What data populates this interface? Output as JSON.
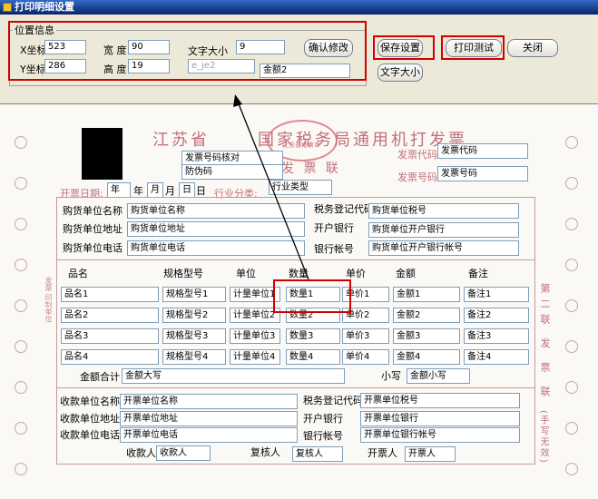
{
  "window": {
    "title": "打印明细设置"
  },
  "position_group": {
    "label": "位置信息",
    "x_label": "X坐标",
    "x_value": "523",
    "y_label": "Y坐标",
    "y_value": "286",
    "width_label": "宽 度",
    "width_value": "90",
    "height_label": "高 度",
    "height_value": "19",
    "font_size_label": "文字大小",
    "font_size_value": "9",
    "field_disabled": "e_je2",
    "field_name": "金额2",
    "confirm_button": "确认修改"
  },
  "toolbar": {
    "save_button": "保存设置",
    "print_test_button": "打印测试",
    "close_button": "关闭",
    "font_size_button": "文字大小"
  },
  "invoice": {
    "province": "江苏省",
    "title": "国家税务局通用机打发票",
    "fa_piao_lian": "发 票 联",
    "seal_text": "江苏省南京市",
    "check_code": "发票号码核对",
    "anti_fake": "防伪码",
    "invoice_code_label": "发票代码",
    "invoice_code": "发票代码",
    "invoice_no_label": "发票号码",
    "invoice_no": "发票号码",
    "date_label": "开票日期:",
    "year_box": "年",
    "year": "年",
    "month_box": "月",
    "month": "月",
    "day_box": "日",
    "day": "日",
    "industry_label": "行业分类:",
    "industry": "行业类型",
    "buyer_name_label": "购货单位名称",
    "buyer_name": "购货单位名称",
    "buyer_addr_label": "购货单位地址",
    "buyer_addr": "购货单位地址",
    "buyer_phone_label": "购货单位电话",
    "buyer_phone": "购货单位电话",
    "buyer_tax_label": "税务登记代码",
    "buyer_tax": "购货单位税号",
    "buyer_bank_label": "开户银行",
    "buyer_bank": "购货单位开户银行",
    "buyer_account_label": "银行帐号",
    "buyer_account": "购货单位开户银行帐号",
    "columns": [
      "品名",
      "规格型号",
      "单位",
      "数量",
      "单价",
      "金额",
      "备注"
    ],
    "rows": [
      [
        "品名1",
        "规格型号1",
        "计量单位1",
        "数量1",
        "单价1",
        "金额1",
        "备注1"
      ],
      [
        "品名2",
        "规格型号2",
        "计量单位2",
        "数量2",
        "单价2",
        "金额2",
        "备注2"
      ],
      [
        "品名3",
        "规格型号3",
        "计量单位3",
        "数量3",
        "单价3",
        "金额3",
        "备注3"
      ],
      [
        "品名4",
        "规格型号4",
        "计量单位4",
        "数量4",
        "单价4",
        "金额4",
        "备注4"
      ]
    ],
    "total_label": "金额合计",
    "total_upper": "金额大写",
    "subtotal_label": "小写",
    "subtotal": "金额小写",
    "seller_name_label": "收款单位名称",
    "seller_name": "开票单位名称",
    "seller_addr_label": "收款单位地址",
    "seller_addr": "开票单位地址",
    "seller_phone_label": "收款单位电话",
    "seller_phone": "开票单位电话",
    "seller_tax_label": "税务登记代码",
    "seller_tax": "开票单位税号",
    "seller_bank_label": "开户银行",
    "seller_bank": "开票单位银行",
    "seller_account_label": "银行帐号",
    "seller_account": "开票单位银行帐号",
    "receiver_label": "收款人",
    "receiver": "收款人",
    "reviewer_label": "复核人",
    "reviewer": "复核人",
    "issuer_label": "开票人",
    "issuer": "开票人",
    "side_lian": "第二联 发 票 联",
    "side_handwritten": "(手写无效)",
    "side_left": "发票 印制单位"
  },
  "colors": {
    "highlight": "#d00000",
    "invoice_ink": "#c0707a"
  }
}
